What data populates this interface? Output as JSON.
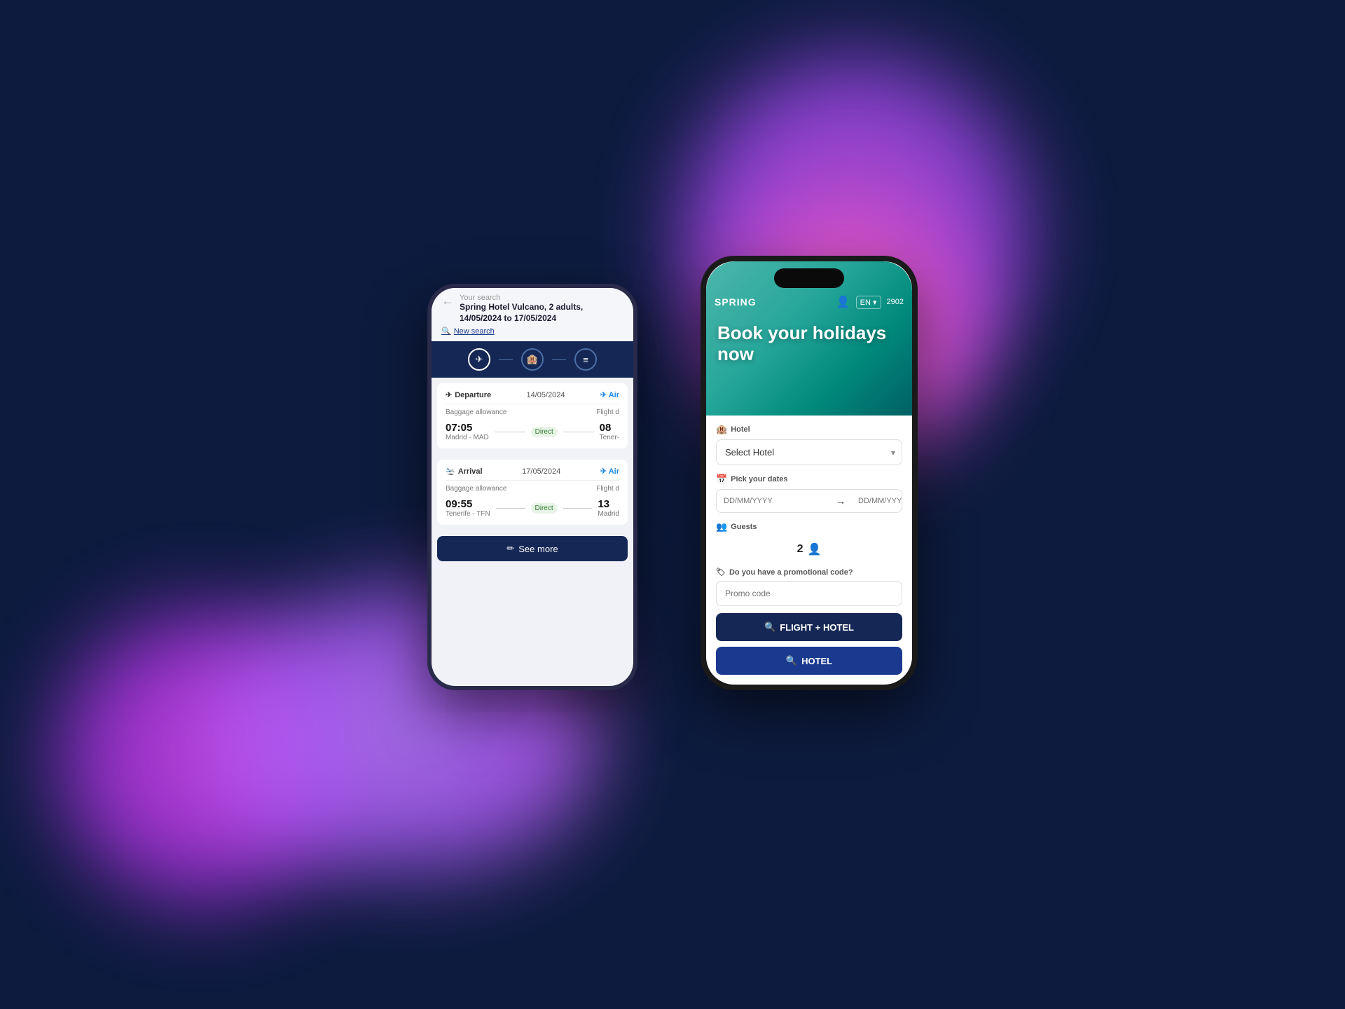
{
  "background": {
    "color": "#0d1b3e"
  },
  "phone_back": {
    "your_search_label": "Your search",
    "search_detail": "Spring Hotel Vulcano, 2 adults, 14/05/2024 to 17/05/2024",
    "new_search_label": "New search",
    "steps": [
      "✈",
      "🏨",
      "≡"
    ],
    "departure_label": "Departure",
    "departure_date": "14/05/2024",
    "airline": "Aire",
    "baggage_label": "Baggage allowance",
    "flight_details_label": "Flight d",
    "departure_time": "07:05",
    "departure_airport": "Madrid - MAD",
    "direct_label": "Direct",
    "arrival_label": "Arrival",
    "arrival_date": "17/05/2024",
    "arrival_time": "09:55",
    "arrival_airport": "Tenerife - TFN",
    "destination": "Madrid",
    "see_more_label": "See more"
  },
  "phone_front": {
    "logo": "SPRING",
    "lang": "EN",
    "points": "2902",
    "hero_title": "Book your holidays now",
    "hotel_section_label": "Hotel",
    "hotel_select_placeholder": "Select Hotel",
    "hotel_select_chevron": "▾",
    "dates_section_label": "Pick your dates",
    "date_from_placeholder": "DD/MM/YYYY",
    "date_to_placeholder": "DD/MM/YYYY",
    "date_arrow": "→",
    "guests_section_label": "Guests",
    "guests_count": "2",
    "guests_icon": "👤",
    "promo_section_label": "Do you have a promotional code?",
    "promo_placeholder": "Promo code",
    "btn_flight_hotel": "FLIGHT + HOTEL",
    "btn_hotel": "HOTEL",
    "search_icon": "🔍"
  }
}
